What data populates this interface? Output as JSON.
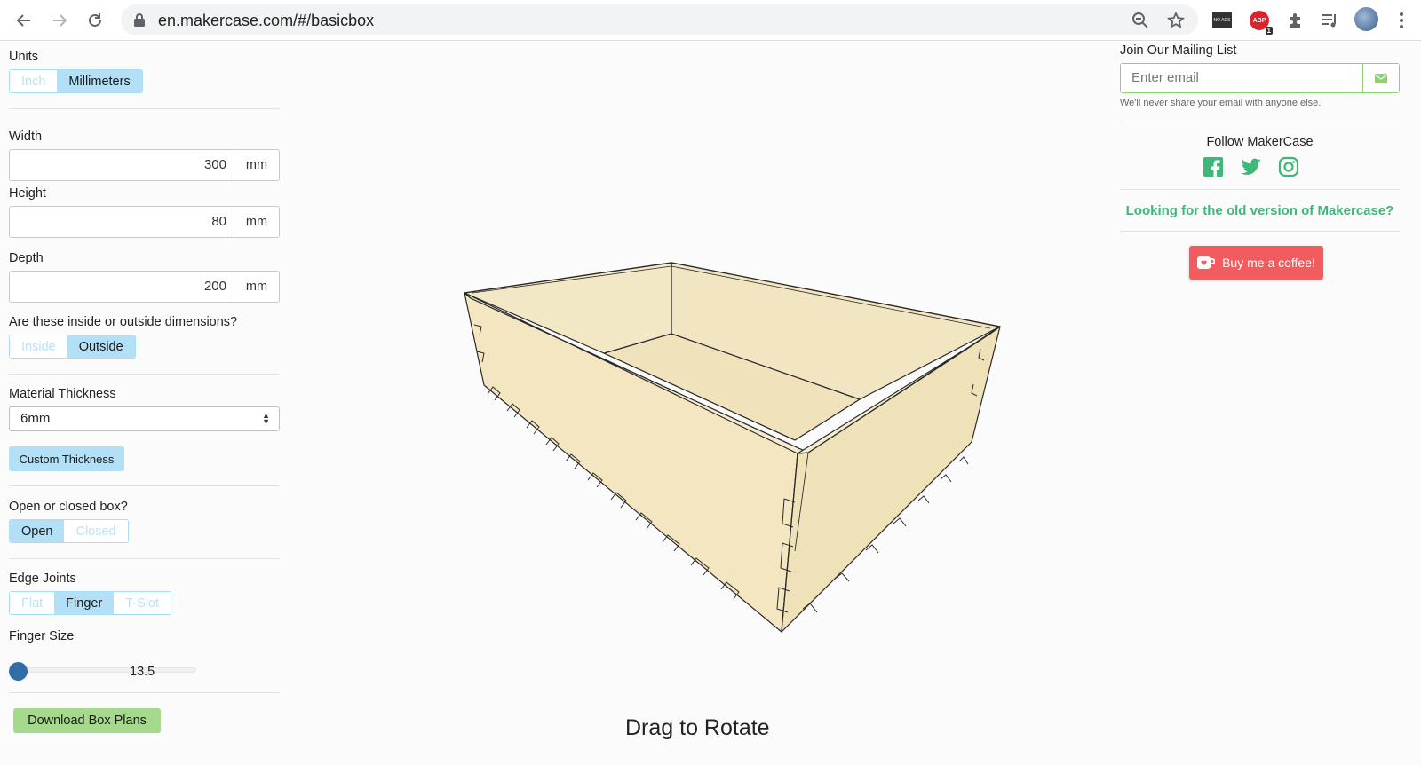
{
  "browser": {
    "url": "en.makercase.com/#/basicbox",
    "ext_noads_label": "NO ADS",
    "ext_abp_badge": "1"
  },
  "units": {
    "label": "Units",
    "options": [
      "Inch",
      "Millimeters"
    ],
    "selected": "Millimeters"
  },
  "dimensions": {
    "width": {
      "label": "Width",
      "value": "300",
      "unit": "mm"
    },
    "height": {
      "label": "Height",
      "value": "80",
      "unit": "mm"
    },
    "depth": {
      "label": "Depth",
      "value": "200",
      "unit": "mm"
    }
  },
  "inside_outside": {
    "label": "Are these inside or outside dimensions?",
    "options": [
      "Inside",
      "Outside"
    ],
    "selected": "Outside"
  },
  "material": {
    "label": "Material Thickness",
    "selected": "6mm",
    "custom_button": "Custom Thickness"
  },
  "open_closed": {
    "label": "Open or closed box?",
    "options": [
      "Open",
      "Closed"
    ],
    "selected": "Open"
  },
  "edge_joints": {
    "label": "Edge Joints",
    "options": [
      "Flat",
      "Finger",
      "T-Slot"
    ],
    "selected": "Finger"
  },
  "finger_size": {
    "label": "Finger Size",
    "value": "13.5",
    "slider_fraction": 0.0
  },
  "download_button": "Download Box Plans",
  "viewer": {
    "hint": "Drag to Rotate",
    "box_color": "#f3e7c4"
  },
  "mailing": {
    "title": "Join Our Mailing List",
    "placeholder": "Enter email",
    "note": "We'll never share your email with anyone else."
  },
  "follow": {
    "title": "Follow MakerCase",
    "icons": [
      "facebook-icon",
      "twitter-icon",
      "instagram-icon"
    ]
  },
  "old_version_link": "Looking for the old version of Makercase?",
  "coffee_button": "Buy me a coffee!",
  "colors": {
    "accent_blue": "#b3e0f7",
    "accent_green": "#a5d98c",
    "link_green": "#3cb878",
    "coffee_red": "#f25c5e"
  }
}
